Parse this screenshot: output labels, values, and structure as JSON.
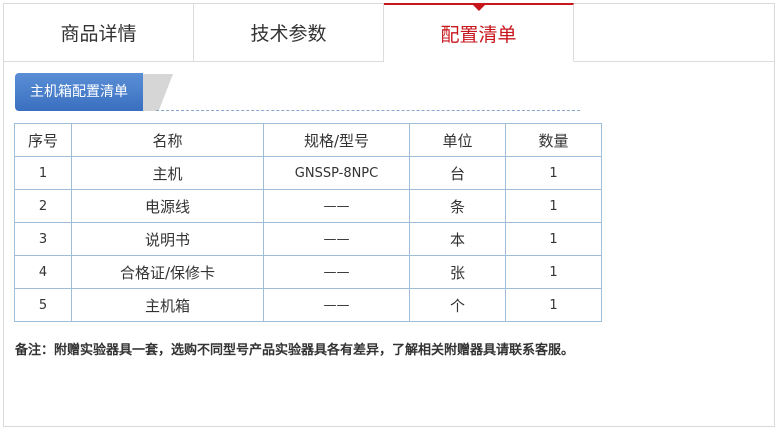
{
  "tabs": [
    {
      "label": "商品详情",
      "active": false
    },
    {
      "label": "技术参数",
      "active": false
    },
    {
      "label": "配置清单",
      "active": true
    }
  ],
  "section": {
    "ribbon_label": "主机箱配置清单"
  },
  "table": {
    "headers": [
      "序号",
      "名称",
      "规格/型号",
      "单位",
      "数量"
    ],
    "rows": [
      [
        "1",
        "主机",
        "GNSSP-8NPC",
        "台",
        "1"
      ],
      [
        "2",
        "电源线",
        "——",
        "条",
        "1"
      ],
      [
        "3",
        "说明书",
        "——",
        "本",
        "1"
      ],
      [
        "4",
        "合格证/保修卡",
        "——",
        "张",
        "1"
      ],
      [
        "5",
        "主机箱",
        "——",
        "个",
        "1"
      ]
    ]
  },
  "note": "备注：附赠实验器具一套，选购不同型号产品实验器具各有差异，了解相关附赠器具请联系客服。",
  "colors": {
    "accent": "#c8161d",
    "ribbon": "#3a6fc0",
    "table_border": "#9fbcd9"
  }
}
